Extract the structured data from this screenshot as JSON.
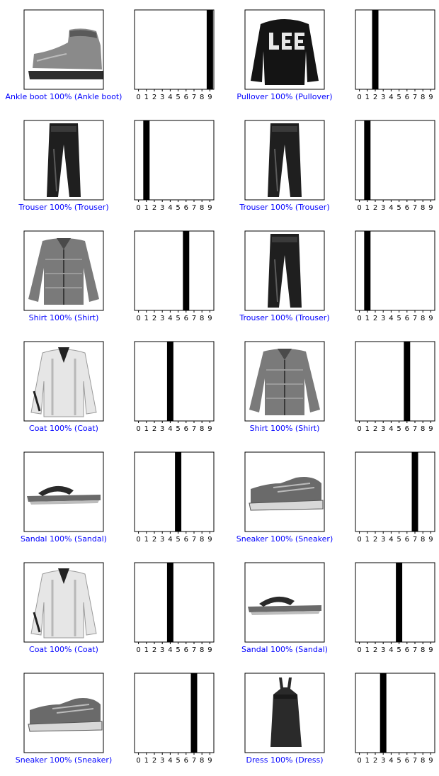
{
  "figure": {
    "label_color": "#0000ff",
    "bar_color": "#000000",
    "image_colormap": "binary"
  },
  "chart_data": [
    {
      "type": "image",
      "label": "Ankle boot 100% (Ankle boot)",
      "depicts": "ankle-boot"
    },
    {
      "type": "bar",
      "categories": [
        "0",
        "1",
        "2",
        "3",
        "4",
        "5",
        "6",
        "7",
        "8",
        "9"
      ],
      "values": [
        0,
        0,
        0,
        0,
        0,
        0,
        0,
        0,
        0,
        1
      ],
      "ylim": [
        0,
        1
      ]
    },
    {
      "type": "image",
      "label": "Pullover 100% (Pullover)",
      "depicts": "pullover"
    },
    {
      "type": "bar",
      "categories": [
        "0",
        "1",
        "2",
        "3",
        "4",
        "5",
        "6",
        "7",
        "8",
        "9"
      ],
      "values": [
        0,
        0,
        1,
        0,
        0,
        0,
        0,
        0,
        0,
        0
      ],
      "ylim": [
        0,
        1
      ]
    },
    {
      "type": "image",
      "label": "Trouser 100% (Trouser)",
      "depicts": "trouser"
    },
    {
      "type": "bar",
      "categories": [
        "0",
        "1",
        "2",
        "3",
        "4",
        "5",
        "6",
        "7",
        "8",
        "9"
      ],
      "values": [
        0,
        1,
        0,
        0,
        0,
        0,
        0,
        0,
        0,
        0
      ],
      "ylim": [
        0,
        1
      ]
    },
    {
      "type": "image",
      "label": "Trouser 100% (Trouser)",
      "depicts": "trouser"
    },
    {
      "type": "bar",
      "categories": [
        "0",
        "1",
        "2",
        "3",
        "4",
        "5",
        "6",
        "7",
        "8",
        "9"
      ],
      "values": [
        0,
        1,
        0,
        0,
        0,
        0,
        0,
        0,
        0,
        0
      ],
      "ylim": [
        0,
        1
      ]
    },
    {
      "type": "image",
      "label": "Shirt 100% (Shirt)",
      "depicts": "shirt"
    },
    {
      "type": "bar",
      "categories": [
        "0",
        "1",
        "2",
        "3",
        "4",
        "5",
        "6",
        "7",
        "8",
        "9"
      ],
      "values": [
        0,
        0,
        0,
        0,
        0,
        0,
        1,
        0,
        0,
        0
      ],
      "ylim": [
        0,
        1
      ]
    },
    {
      "type": "image",
      "label": "Trouser 100% (Trouser)",
      "depicts": "trouser"
    },
    {
      "type": "bar",
      "categories": [
        "0",
        "1",
        "2",
        "3",
        "4",
        "5",
        "6",
        "7",
        "8",
        "9"
      ],
      "values": [
        0,
        1,
        0,
        0,
        0,
        0,
        0,
        0,
        0,
        0
      ],
      "ylim": [
        0,
        1
      ]
    },
    {
      "type": "image",
      "label": "Coat 100% (Coat)",
      "depicts": "coat"
    },
    {
      "type": "bar",
      "categories": [
        "0",
        "1",
        "2",
        "3",
        "4",
        "5",
        "6",
        "7",
        "8",
        "9"
      ],
      "values": [
        0,
        0,
        0,
        0,
        1,
        0,
        0,
        0,
        0,
        0
      ],
      "ylim": [
        0,
        1
      ]
    },
    {
      "type": "image",
      "label": "Shirt 100% (Shirt)",
      "depicts": "shirt"
    },
    {
      "type": "bar",
      "categories": [
        "0",
        "1",
        "2",
        "3",
        "4",
        "5",
        "6",
        "7",
        "8",
        "9"
      ],
      "values": [
        0,
        0,
        0,
        0,
        0,
        0,
        1,
        0,
        0,
        0
      ],
      "ylim": [
        0,
        1
      ]
    },
    {
      "type": "image",
      "label": "Sandal 100% (Sandal)",
      "depicts": "sandal"
    },
    {
      "type": "bar",
      "categories": [
        "0",
        "1",
        "2",
        "3",
        "4",
        "5",
        "6",
        "7",
        "8",
        "9"
      ],
      "values": [
        0,
        0,
        0,
        0,
        0,
        1,
        0,
        0,
        0,
        0
      ],
      "ylim": [
        0,
        1
      ]
    },
    {
      "type": "image",
      "label": "Sneaker 100% (Sneaker)",
      "depicts": "sneaker"
    },
    {
      "type": "bar",
      "categories": [
        "0",
        "1",
        "2",
        "3",
        "4",
        "5",
        "6",
        "7",
        "8",
        "9"
      ],
      "values": [
        0,
        0,
        0,
        0,
        0,
        0,
        0,
        1,
        0,
        0
      ],
      "ylim": [
        0,
        1
      ]
    },
    {
      "type": "image",
      "label": "Coat 100% (Coat)",
      "depicts": "coat"
    },
    {
      "type": "bar",
      "categories": [
        "0",
        "1",
        "2",
        "3",
        "4",
        "5",
        "6",
        "7",
        "8",
        "9"
      ],
      "values": [
        0,
        0,
        0,
        0,
        1,
        0,
        0,
        0,
        0,
        0
      ],
      "ylim": [
        0,
        1
      ]
    },
    {
      "type": "image",
      "label": "Sandal 100% (Sandal)",
      "depicts": "sandal"
    },
    {
      "type": "bar",
      "categories": [
        "0",
        "1",
        "2",
        "3",
        "4",
        "5",
        "6",
        "7",
        "8",
        "9"
      ],
      "values": [
        0,
        0,
        0,
        0,
        0,
        1,
        0,
        0,
        0,
        0
      ],
      "ylim": [
        0,
        1
      ]
    },
    {
      "type": "image",
      "label": "Sneaker 100% (Sneaker)",
      "depicts": "sneaker"
    },
    {
      "type": "bar",
      "categories": [
        "0",
        "1",
        "2",
        "3",
        "4",
        "5",
        "6",
        "7",
        "8",
        "9"
      ],
      "values": [
        0,
        0,
        0,
        0,
        0,
        0,
        0,
        1,
        0,
        0
      ],
      "ylim": [
        0,
        1
      ]
    },
    {
      "type": "image",
      "label": "Dress 100% (Dress)",
      "depicts": "dress"
    },
    {
      "type": "bar",
      "categories": [
        "0",
        "1",
        "2",
        "3",
        "4",
        "5",
        "6",
        "7",
        "8",
        "9"
      ],
      "values": [
        0,
        0,
        0,
        1,
        0,
        0,
        0,
        0,
        0,
        0
      ],
      "ylim": [
        0,
        1
      ]
    }
  ]
}
